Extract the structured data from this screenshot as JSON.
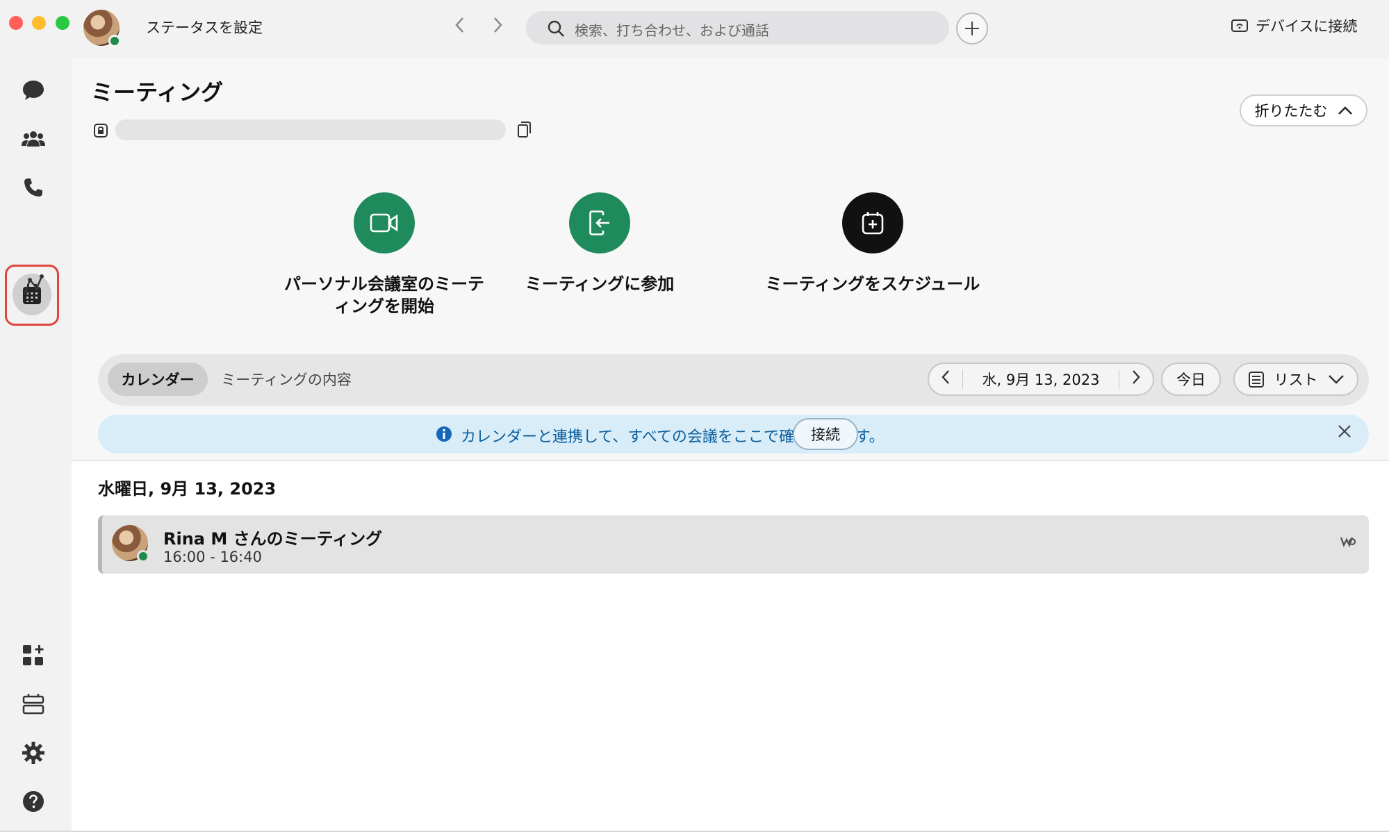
{
  "titlebar": {
    "status_label": "ステータスを設定",
    "search_placeholder": "検索、打ち合わせ、および通話",
    "device_label": "デバイスに接続"
  },
  "sidebar": {
    "items": [
      {
        "name": "messaging",
        "icon": "chat-bubble-icon"
      },
      {
        "name": "teams",
        "icon": "people-icon"
      },
      {
        "name": "calling",
        "icon": "phone-icon"
      },
      {
        "name": "meetings",
        "icon": "calendar-icon",
        "active": true
      },
      {
        "name": "vidcast",
        "icon": "vidcast-icon"
      }
    ],
    "bottom_items": [
      {
        "name": "apps",
        "icon": "apps-add-icon"
      },
      {
        "name": "devices",
        "icon": "device-icon"
      },
      {
        "name": "settings",
        "icon": "gear-icon"
      },
      {
        "name": "help",
        "icon": "help-icon"
      }
    ]
  },
  "main": {
    "title": "ミーティング",
    "collapse_label": "折りたたむ",
    "actions": [
      {
        "label": "パーソナル会議室のミーティングを開始",
        "icon": "video-camera-icon",
        "color": "#1f8a5c"
      },
      {
        "label": "ミーティングに参加",
        "icon": "join-icon",
        "color": "#1f8a5c"
      },
      {
        "label": "ミーティングをスケジュール",
        "icon": "schedule-icon",
        "color": "#111111"
      }
    ],
    "tabs": [
      {
        "label": "カレンダー",
        "active": true
      },
      {
        "label": "ミーティングの内容",
        "active": false
      }
    ],
    "date_display": "水, 9月 13, 2023",
    "today_label": "今日",
    "view_label": "リスト",
    "banner": {
      "message": "カレンダーと連携して、すべての会議をここで確認できます。",
      "connect_label": "接続"
    },
    "day_heading": "水曜日, 9月 13, 2023",
    "meetings": [
      {
        "title": "Rina M さんのミーティング",
        "time": "16:00  -  16:40"
      }
    ]
  },
  "colors": {
    "accent_green": "#1f8a5c",
    "active_outline": "#e0443a",
    "banner_bg": "#d9edf9",
    "banner_text": "#0b5e9c"
  }
}
